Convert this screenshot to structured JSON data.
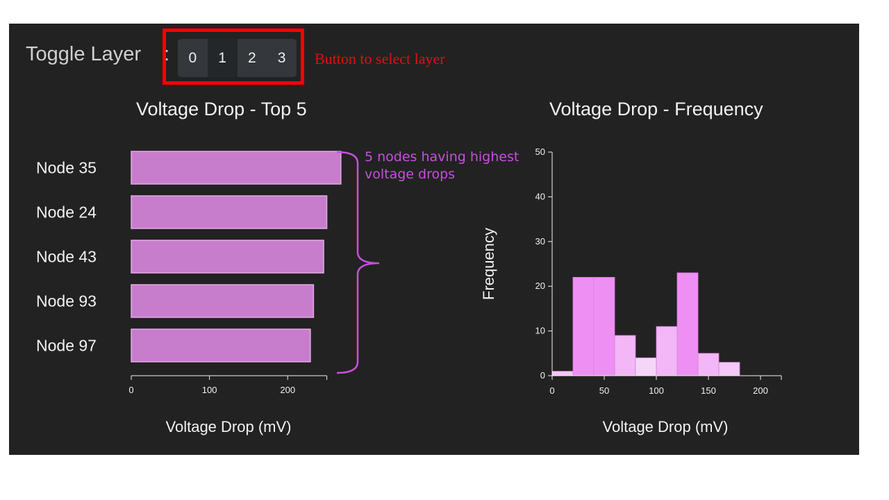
{
  "toolbar": {
    "label": "Toggle Layer",
    "colon": ":",
    "layers": [
      "0",
      "1",
      "2",
      "3"
    ],
    "active_layer": "1"
  },
  "annotations": {
    "button_callout": "Button to select layer",
    "brace_callout": "5 nodes having highest voltage drops",
    "button_callout_color": "#e01010",
    "brace_color": "#c84fe0"
  },
  "chart_data": [
    {
      "type": "bar",
      "orientation": "horizontal",
      "title": "Voltage Drop - Top 5",
      "categories": [
        "Node 35",
        "Node 24",
        "Node 43",
        "Node 93",
        "Node 97"
      ],
      "values": [
        268,
        250,
        246,
        233,
        229
      ],
      "xlabel": "Voltage Drop (mV)",
      "ylabel": "",
      "xlim": [
        0,
        250
      ],
      "xticks": [
        0,
        100,
        200
      ],
      "color": "#c77dcc",
      "grid": false
    },
    {
      "type": "bar",
      "title": "Voltage Drop - Frequency",
      "bins": [
        [
          0,
          20
        ],
        [
          20,
          40
        ],
        [
          40,
          60
        ],
        [
          60,
          80
        ],
        [
          80,
          100
        ],
        [
          100,
          120
        ],
        [
          120,
          140
        ],
        [
          140,
          160
        ],
        [
          160,
          180
        ]
      ],
      "values": [
        1,
        22,
        22,
        9,
        4,
        11,
        23,
        5,
        3
      ],
      "xlabel": "Voltage Drop (mV)",
      "ylabel": "Frequency",
      "xlim": [
        0,
        220
      ],
      "ylim": [
        0,
        50
      ],
      "xticks": [
        0,
        50,
        100,
        150,
        200
      ],
      "yticks": [
        0,
        10,
        20,
        30,
        40,
        50
      ],
      "colors": [
        "#f3c8f6",
        "#ee90f3",
        "#ee90f3",
        "#f3b6f6",
        "#f6d6f8",
        "#f3b6f6",
        "#ee90f3",
        "#f3b6f6",
        "#f3c8f6"
      ],
      "grid": false
    }
  ]
}
